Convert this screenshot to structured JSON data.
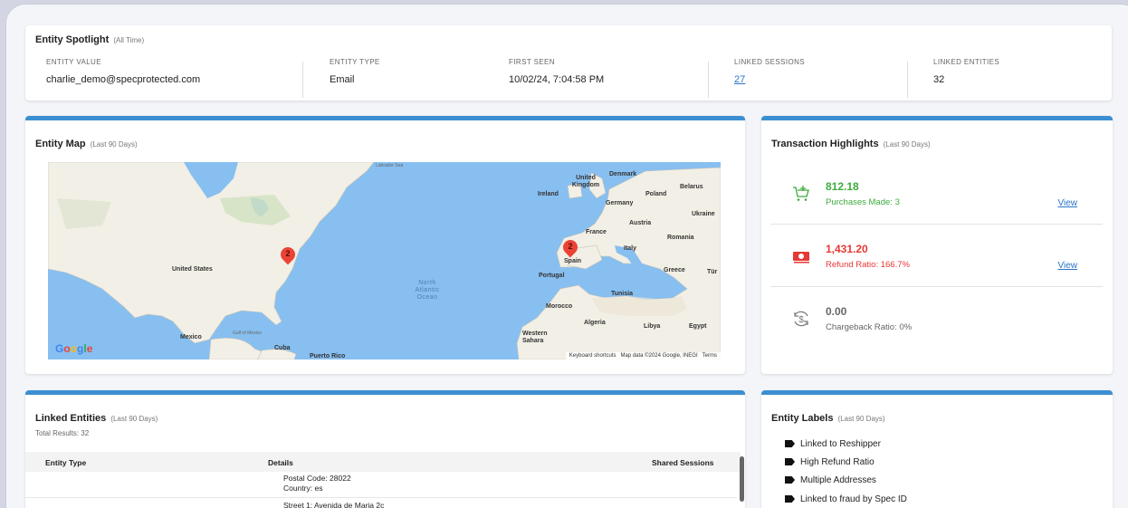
{
  "spotlight": {
    "title": "Entity Spotlight",
    "subtitle": "(All Time)",
    "columns": [
      {
        "label": "ENTITY VALUE",
        "value": "charlie_demo@specprotected.com"
      },
      {
        "label": "ENTITY TYPE",
        "value": "Email"
      },
      {
        "label": "FIRST SEEN",
        "value": "10/02/24, 7:04:58 PM"
      },
      {
        "label": "LINKED SESSIONS",
        "value": "27"
      },
      {
        "label": "LINKED ENTITIES",
        "value": "32"
      }
    ]
  },
  "map": {
    "title": "Entity Map",
    "subtitle": "(Last 90 Days)",
    "labels": {
      "labrador_sea": "Labrador Sea",
      "united_states": "United States",
      "mexico": "Mexico",
      "cuba": "Cuba",
      "puerto_rico": "Puerto Rico",
      "gulf": "Gulf of Mexico",
      "ocean": "North Atlantic Ocean",
      "ireland": "Ireland",
      "uk": "United Kingdom",
      "denmark": "Denmark",
      "germany": "Germany",
      "poland": "Poland",
      "belarus": "Belarus",
      "ukraine": "Ukraine",
      "austria": "Austria",
      "france": "France",
      "romania": "Romania",
      "italy": "Italy",
      "spain": "Spain",
      "portugal": "Portugal",
      "greece": "Greece",
      "turkey": "Tür",
      "tunisia": "Tunisia",
      "morocco": "Morocco",
      "algeria": "Algeria",
      "libya": "Libya",
      "egypt": "Egypt",
      "western_sahara": "Western Sahara"
    },
    "pins": [
      {
        "name": "us-east",
        "count": "2"
      },
      {
        "name": "spain",
        "count": "2"
      }
    ],
    "google": "Google",
    "attribution": {
      "shortcuts": "Keyboard shortcuts",
      "data": "Map data ©2024 Google, INEGI",
      "terms": "Terms"
    }
  },
  "transactions": {
    "title": "Transaction Highlights",
    "subtitle": "(Last 90 Days)",
    "rows": [
      {
        "amount": "812.18",
        "detail": "Purchases Made: 3",
        "view": "View",
        "icon": "cart-icon",
        "color": "#3dab3d"
      },
      {
        "amount": "1,431.20",
        "detail": "Refund Ratio: 166.7%",
        "view": "View",
        "icon": "cash-icon",
        "color": "#e53935"
      },
      {
        "amount": "0.00",
        "detail": "Chargeback Ratio: 0%",
        "view": "",
        "icon": "chargeback-icon",
        "color": "#666666"
      }
    ]
  },
  "linked": {
    "title": "Linked Entities",
    "subtitle": "(Last 90 Days)",
    "total": "Total Results: 32",
    "headers": {
      "type": "Entity Type",
      "details": "Details",
      "shared": "Shared Sessions"
    },
    "rows": [
      {
        "details": [
          "Postal Code: 28022",
          "Country: es"
        ]
      },
      {
        "details": [
          "Street 1: Avenida de Maria 2c"
        ]
      }
    ]
  },
  "labels": {
    "title": "Entity Labels",
    "subtitle": "(Last 90 Days)",
    "items": [
      "Linked to Reshipper",
      "High Refund Ratio",
      "Multiple Addresses",
      "Linked to fraud by Spec ID"
    ]
  }
}
